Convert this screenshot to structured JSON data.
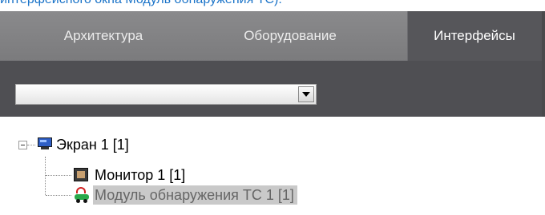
{
  "caption": "интерфейсного окна Модуль обнаружения ТС).",
  "tabs": [
    {
      "label": "Архитектура",
      "active": false
    },
    {
      "label": "Оборудование",
      "active": false
    },
    {
      "label": "Интерфейсы",
      "active": true
    }
  ],
  "filter": {
    "value": ""
  },
  "tree": {
    "root": {
      "label": "Экран 1 [1]",
      "icon": "screen-icon",
      "expanded": true
    },
    "children": [
      {
        "label": "Монитор 1 [1]",
        "icon": "monitor-icon",
        "selected": false
      },
      {
        "label": "Модуль обнаружения ТС 1 [1]",
        "icon": "vehicle-detection-icon",
        "selected": true
      }
    ]
  },
  "colors": {
    "tabbar": "#7f7f81",
    "active_tab": "#56565a",
    "panel": "#4f4f53",
    "selection": "#c9c9c9",
    "caption": "#1a73c8"
  }
}
